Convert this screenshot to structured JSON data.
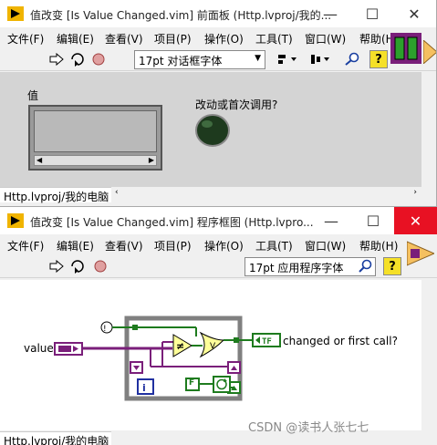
{
  "front_panel": {
    "title": "值改变 [Is Value Changed.vim] 前面板 (Http.lvproj/我的...",
    "menu": [
      "文件(F)",
      "编辑(E)",
      "查看(V)",
      "项目(P)",
      "操作(O)",
      "工具(T)",
      "窗口(W)",
      "帮助(H)"
    ],
    "font": "17pt 对话框字体",
    "value_label": "值",
    "led_label": "改动或首次调用?",
    "status": "Http.lvproj/我的电脑"
  },
  "block_diagram": {
    "title": "值改变 [Is Value Changed.vim] 程序框图 (Http.lvpro...",
    "menu": [
      "文件(F)",
      "编辑(E)",
      "查看(V)",
      "项目(P)",
      "操作(O)",
      "工具(T)",
      "窗口(W)",
      "帮助(H)"
    ],
    "font": "17pt 应用程序字体",
    "value_label": "value",
    "output_label": "changed or first call?",
    "bool_constant": "F",
    "status": "Http.lvproj/我的电脑"
  },
  "window_controls": {
    "minimize": "—",
    "maximize": "☐",
    "close": "✕"
  },
  "colors": {
    "close_red": "#e81123",
    "bool_green": "#1e7b1e",
    "variant_purple": "#7a1f7a",
    "structure_gray": "#808080"
  },
  "watermark": "CSDN @读书人张七七"
}
